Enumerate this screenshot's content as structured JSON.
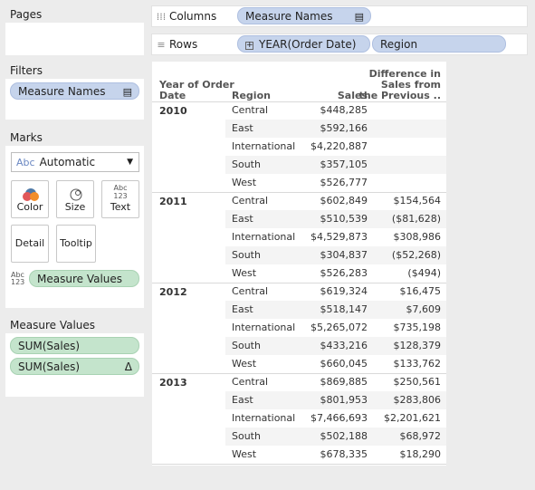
{
  "pages": {
    "title": "Pages"
  },
  "filters": {
    "title": "Filters",
    "pill": "Measure Names"
  },
  "marks": {
    "title": "Marks",
    "type_icon": "Abc",
    "type": "Automatic",
    "buttons": {
      "color": "Color",
      "size": "Size",
      "text": "Text",
      "detail": "Detail",
      "tooltip": "Tooltip"
    },
    "text_glyph_top": "Abc",
    "text_glyph_bot": "123",
    "field_pill": "Measure Values"
  },
  "measure_values": {
    "title": "Measure Values",
    "pills": [
      "SUM(Sales)",
      "SUM(Sales)"
    ],
    "delta_glyph": "Δ"
  },
  "columns": {
    "label": "Columns",
    "pill": "Measure Names"
  },
  "rows": {
    "label": "Rows",
    "pill1": "YEAR(Order Date)",
    "pill2": "Region"
  },
  "table": {
    "headers": {
      "year": [
        "Year of Order",
        "Date"
      ],
      "region": "Region",
      "sales": "Sales",
      "diff": [
        "Difference in",
        "Sales from",
        "the Previous .."
      ]
    },
    "groups": [
      {
        "year": "2010",
        "rows": [
          {
            "region": "Central",
            "sales": "$448,285",
            "diff": ""
          },
          {
            "region": "East",
            "sales": "$592,166",
            "diff": ""
          },
          {
            "region": "International",
            "sales": "$4,220,887",
            "diff": ""
          },
          {
            "region": "South",
            "sales": "$357,105",
            "diff": ""
          },
          {
            "region": "West",
            "sales": "$526,777",
            "diff": ""
          }
        ]
      },
      {
        "year": "2011",
        "rows": [
          {
            "region": "Central",
            "sales": "$602,849",
            "diff": "$154,564"
          },
          {
            "region": "East",
            "sales": "$510,539",
            "diff": "($81,628)"
          },
          {
            "region": "International",
            "sales": "$4,529,873",
            "diff": "$308,986"
          },
          {
            "region": "South",
            "sales": "$304,837",
            "diff": "($52,268)"
          },
          {
            "region": "West",
            "sales": "$526,283",
            "diff": "($494)"
          }
        ]
      },
      {
        "year": "2012",
        "rows": [
          {
            "region": "Central",
            "sales": "$619,324",
            "diff": "$16,475"
          },
          {
            "region": "East",
            "sales": "$518,147",
            "diff": "$7,609"
          },
          {
            "region": "International",
            "sales": "$5,265,072",
            "diff": "$735,198"
          },
          {
            "region": "South",
            "sales": "$433,216",
            "diff": "$128,379"
          },
          {
            "region": "West",
            "sales": "$660,045",
            "diff": "$133,762"
          }
        ]
      },
      {
        "year": "2013",
        "rows": [
          {
            "region": "Central",
            "sales": "$869,885",
            "diff": "$250,561"
          },
          {
            "region": "East",
            "sales": "$801,953",
            "diff": "$283,806"
          },
          {
            "region": "International",
            "sales": "$7,466,693",
            "diff": "$2,201,621"
          },
          {
            "region": "South",
            "sales": "$502,188",
            "diff": "$68,972"
          },
          {
            "region": "West",
            "sales": "$678,335",
            "diff": "$18,290"
          }
        ]
      }
    ]
  }
}
